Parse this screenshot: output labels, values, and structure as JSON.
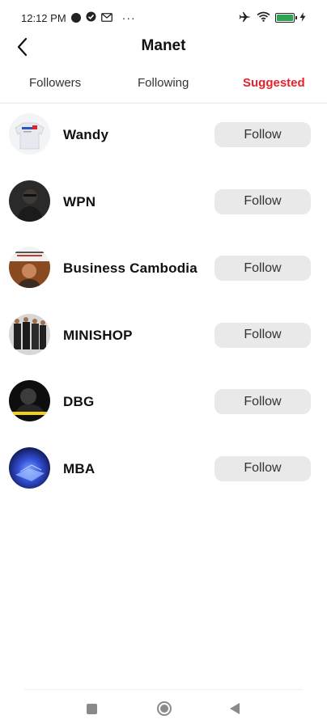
{
  "status_bar": {
    "time": "12:12 PM",
    "dots": "···",
    "icons": [
      "app-icon-1",
      "check-badge-icon",
      "mail-icon",
      "airplane-icon",
      "wifi-icon",
      "battery-icon",
      "charging-bolt-icon"
    ]
  },
  "header": {
    "title": "Manet",
    "back_icon": "chevron-left-icon"
  },
  "tabs": [
    {
      "label": "Followers",
      "active": false
    },
    {
      "label": "Following",
      "active": false
    },
    {
      "label": "Suggested",
      "active": true
    }
  ],
  "accent_color": "#e8202a",
  "suggested": [
    {
      "name": "Wandy",
      "action": "Follow"
    },
    {
      "name": "WPN",
      "action": "Follow"
    },
    {
      "name": "Business  Cambodia",
      "action": "Follow"
    },
    {
      "name": "MINISHOP",
      "action": "Follow"
    },
    {
      "name": "DBG",
      "action": "Follow"
    },
    {
      "name": "MBA",
      "action": "Follow"
    }
  ],
  "navbar": {
    "icons": [
      "recents-icon",
      "home-icon",
      "back-icon"
    ]
  }
}
